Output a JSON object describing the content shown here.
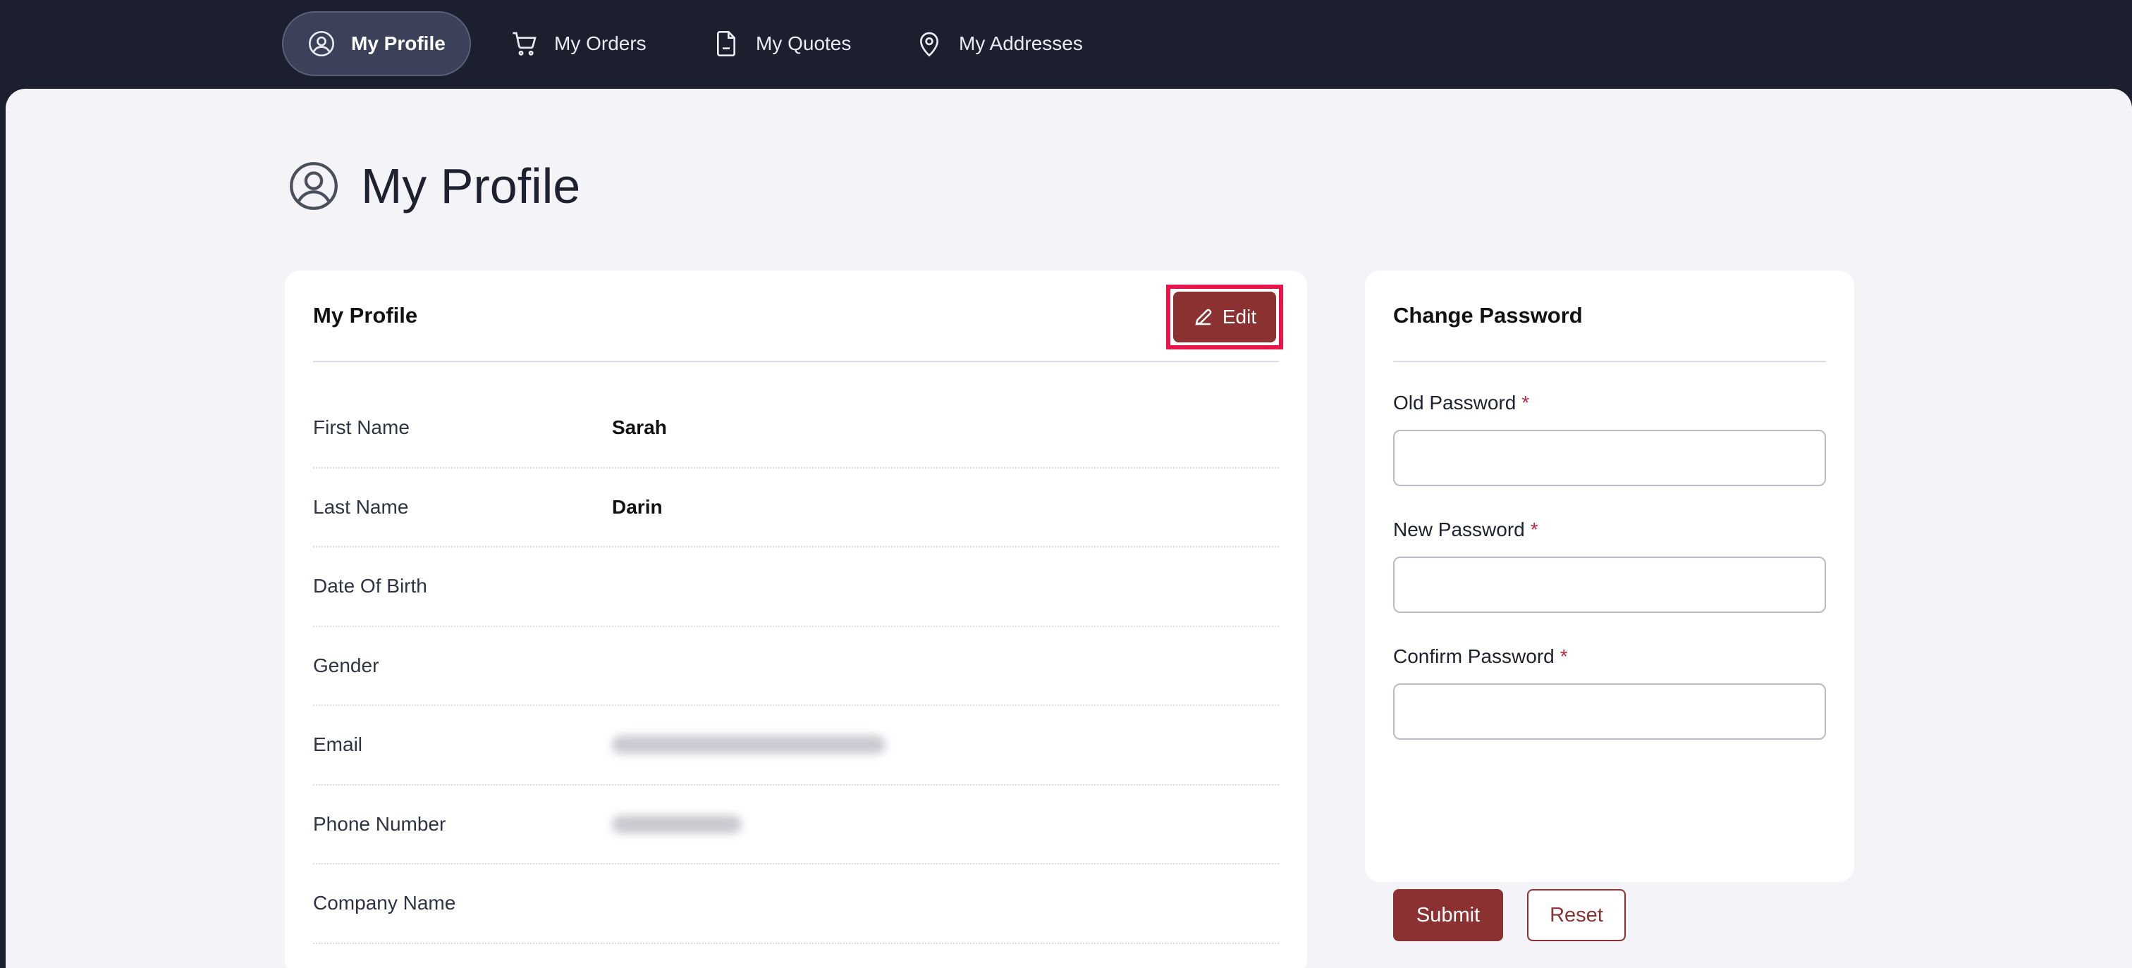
{
  "nav": {
    "items": [
      {
        "label": "My Profile",
        "icon": "user-circle-icon",
        "active": true
      },
      {
        "label": "My Orders",
        "icon": "cart-icon",
        "active": false
      },
      {
        "label": "My Quotes",
        "icon": "document-icon",
        "active": false
      },
      {
        "label": "My Addresses",
        "icon": "map-pin-icon",
        "active": false
      }
    ]
  },
  "page": {
    "title": "My Profile",
    "icon": "user-circle-icon"
  },
  "profile_card": {
    "title": "My Profile",
    "edit_label": "Edit",
    "fields": [
      {
        "label": "First Name",
        "value": "Sarah"
      },
      {
        "label": "Last Name",
        "value": "Darin"
      },
      {
        "label": "Date Of Birth",
        "value": ""
      },
      {
        "label": "Gender",
        "value": ""
      },
      {
        "label": "Email",
        "value": "",
        "redacted": true
      },
      {
        "label": "Phone Number",
        "value": "",
        "redacted": true
      },
      {
        "label": "Company Name",
        "value": ""
      }
    ]
  },
  "password_card": {
    "title": "Change Password",
    "fields": [
      {
        "label": "Old Password",
        "required_mark": "*",
        "value": ""
      },
      {
        "label": "New Password",
        "required_mark": "*",
        "value": ""
      },
      {
        "label": "Confirm Password",
        "required_mark": "*",
        "value": ""
      }
    ],
    "submit_label": "Submit",
    "reset_label": "Reset"
  },
  "colors": {
    "nav_bg": "#1b1f2e",
    "page_bg": "#f3f3f8",
    "brand": "#8b3131",
    "highlight": "#e8154a",
    "required": "#c2283d"
  }
}
